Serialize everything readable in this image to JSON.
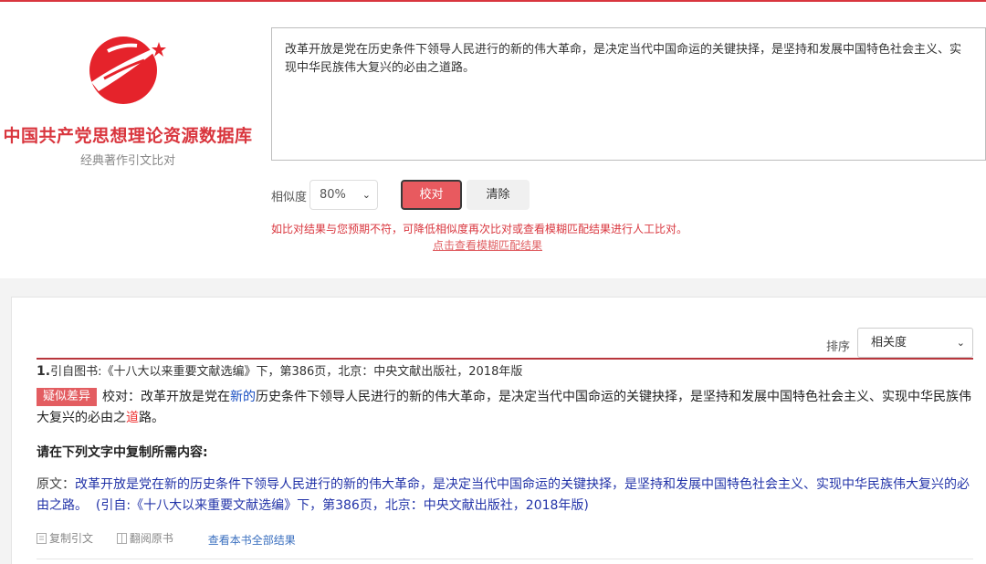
{
  "brand": {
    "title": "中国共产党思想理论资源数据库",
    "subtitle": "经典著作引文比对"
  },
  "query": {
    "text": "改革开放是党在历史条件下领导人民进行的新的伟大革命，是决定当代中国命运的关键抉择，是坚持和发展中国特色社会主义、实现中华民族伟大复兴的必由之道路。"
  },
  "controls": {
    "similarity_label": "相似度",
    "similarity_value": "80%",
    "check_button": "校对",
    "clear_button": "清除",
    "hint": "如比对结果与您预期不符，可降低相似度再次比对或查看模糊匹配结果进行人工比对。",
    "fuzzy_link": "点击查看模糊匹配结果"
  },
  "results": {
    "sort_label": "排序",
    "sort_value": "相关度",
    "items": [
      {
        "number": "1.",
        "citation": "引自图书:《十八大以来重要文献选编》下，第386页，北京：中央文献出版社，2018年版",
        "badge": "疑似差异",
        "check_prefix": "校对：改革开放是党在",
        "check_diff_inserted": "新的",
        "check_middle": "历史条件下领导人民进行的新的伟大革命，是决定当代中国命运的关键抉择，是坚持和发展中国特色社会主义、实现中华民族伟大复兴的必由之",
        "check_diff_removed": "道",
        "check_suffix": "路。",
        "copy_heading": "请在下列文字中复制所需内容:",
        "original_label": "原文：",
        "original_text": "改革开放是党在新的历史条件下领导人民进行的新的伟大革命，是决定当代中国命运的关键抉择，是坚持和发展中国特色社会主义、实现中华民族伟大复兴的必由之路。",
        "original_source": "(引自:《十八大以来重要文献选编》下，第386页，北京：中央文献出版社，2018年版)",
        "actions": {
          "copy": "复制引文",
          "view_book": "翻阅原书",
          "all_results": "查看本书全部结果"
        }
      }
    ]
  },
  "colors": {
    "accent_red": "#d9363e",
    "button_red": "#e85a5f",
    "link_blue": "#3a6fbf",
    "text_blue": "#2233a8"
  }
}
